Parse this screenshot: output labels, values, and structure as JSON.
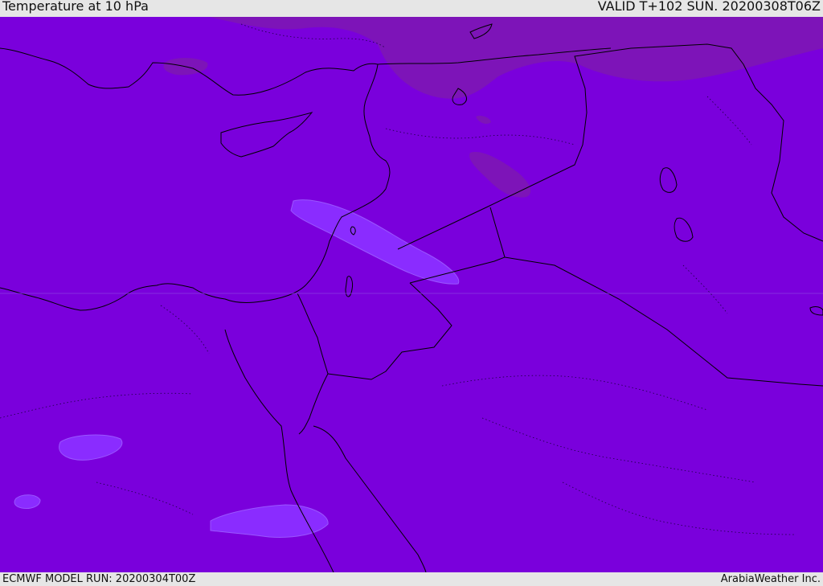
{
  "header": {
    "title": "Temperature at 10 hPa",
    "valid": "VALID T+102 SUN. 20200308T06Z"
  },
  "footer": {
    "model_run": "ECMWF MODEL RUN: 20200304T00Z",
    "credit": "ArabiaWeather Inc."
  },
  "map": {
    "base_color": "#7a00dc",
    "warm_patch_color": "#7d14b8",
    "cold_patch_color": "#8a2cff",
    "coastline_color": "#000000"
  }
}
